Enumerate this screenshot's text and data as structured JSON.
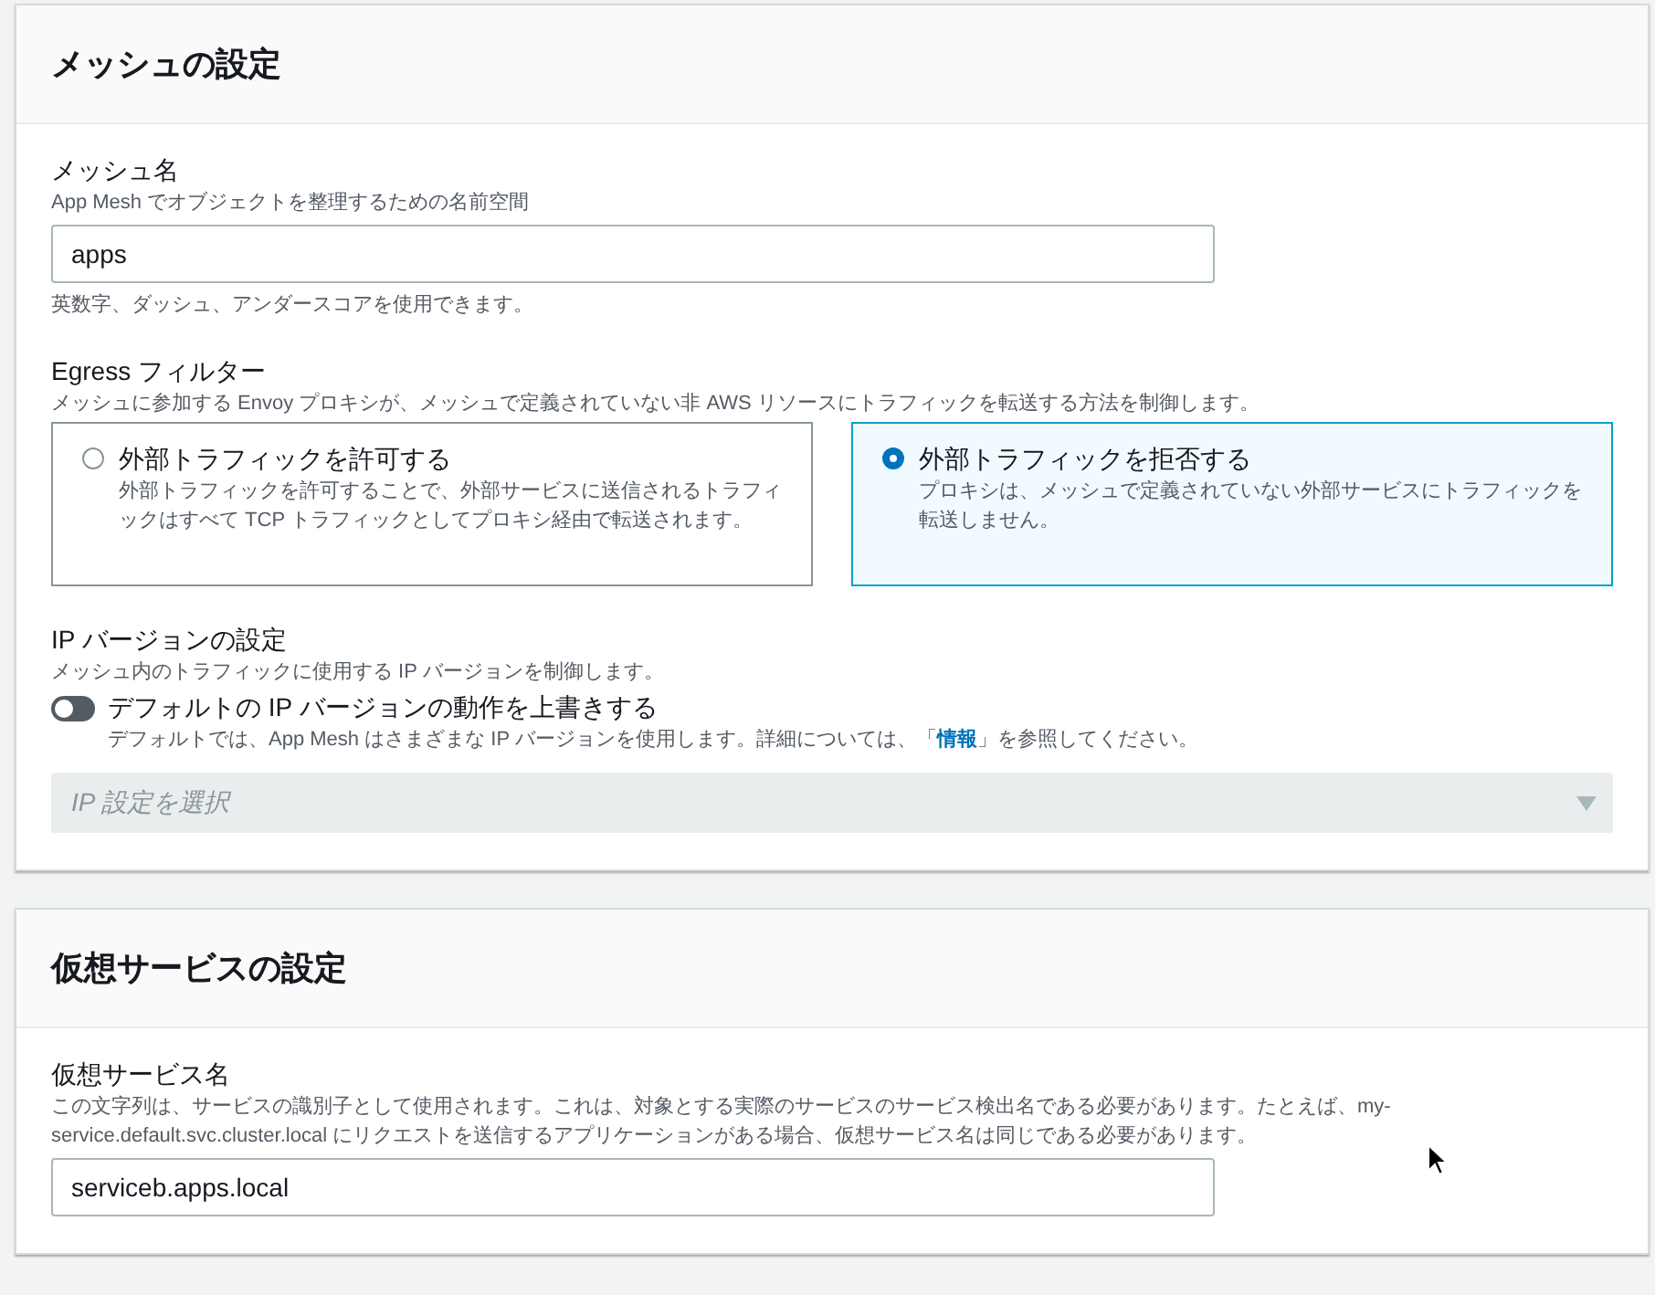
{
  "panels": [
    {
      "title": "メッシュの設定",
      "fields": [
        {
          "kind": "text",
          "label": "メッシュ名",
          "description": "App Mesh でオブジェクトを整理するための名前空間",
          "value": "apps",
          "constraint": "英数字、ダッシュ、アンダースコアを使用できます。"
        },
        {
          "kind": "radio",
          "label": "Egress フィルター",
          "description": "メッシュに参加する Envoy プロキシが、メッシュで定義されていない非 AWS リソースにトラフィックを転送する方法を制御します。",
          "options": [
            {
              "label": "外部トラフィックを許可する",
              "description": "外部トラフィックを許可することで、外部サービスに送信されるトラフィックはすべて TCP トラフィックとしてプロキシ経由で転送されます。",
              "selected": false
            },
            {
              "label": "外部トラフィックを拒否する",
              "description": "プロキシは、メッシュで定義されていない外部サービスにトラフィックを転送しません。",
              "selected": true
            }
          ]
        },
        {
          "kind": "toggle",
          "label": "IP バージョンの設定",
          "description": "メッシュ内のトラフィックに使用する IP バージョンを制御します。",
          "toggle": {
            "label": "デフォルトの IP バージョンの動作を上書きする",
            "on": false,
            "help_before": "デフォルトでは、App Mesh はさまざまな IP バージョンを使用します。詳細については、「",
            "help_link": "情報",
            "help_after": "」を参照してください。"
          },
          "select": {
            "placeholder": "IP 設定を選択",
            "disabled": true
          }
        }
      ]
    },
    {
      "title": "仮想サービスの設定",
      "fields": [
        {
          "kind": "text",
          "label": "仮想サービス名",
          "description": "この文字列は、サービスの識別子として使用されます。これは、対象とする実際のサービスのサービス検出名である必要があります。たとえば、my-service.default.svc.cluster.local にリクエストを送信するアプリケーションがある場合、仮想サービス名は同じである必要があります。",
          "value": "serviceb.apps.local"
        }
      ]
    }
  ]
}
